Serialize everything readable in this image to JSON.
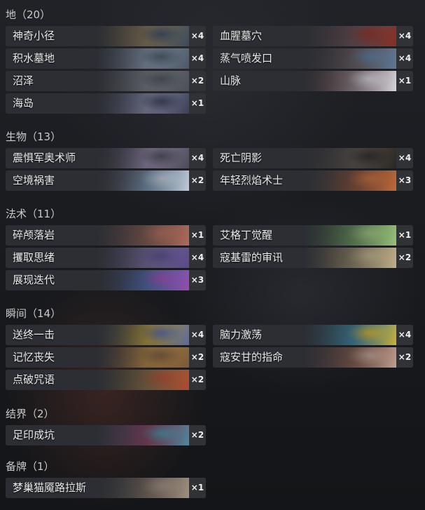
{
  "sections": [
    {
      "title": "地（20）",
      "cards": [
        {
          "name": "神奇小径",
          "qty": "×4",
          "art": [
            "#6e5a3c",
            "#8c7a58",
            "#3a4a5c"
          ]
        },
        {
          "name": "血腥墓穴",
          "qty": "×4",
          "art": [
            "#4a3a44",
            "#6a4a4e",
            "#8a2e24"
          ]
        },
        {
          "name": "积水墓地",
          "qty": "×4",
          "art": [
            "#5a6a7a",
            "#8a9ab0",
            "#4a5866"
          ]
        },
        {
          "name": "蒸气喷发口",
          "qty": "×4",
          "art": [
            "#3a3436",
            "#6a5a5e",
            "#5a7a9a"
          ]
        },
        {
          "name": "沼泽",
          "qty": "×2",
          "art": [
            "#5a5e66",
            "#7a7e86",
            "#4a4e56"
          ]
        },
        {
          "name": "山脉",
          "qty": "×1",
          "art": [
            "#6a3a36",
            "#9a8a8e",
            "#d8d4dc"
          ]
        },
        {
          "name": "海岛",
          "qty": "×1",
          "art": [
            "#4a4e6a",
            "#8a8eb0",
            "#3a3e56"
          ]
        }
      ]
    },
    {
      "title": "生物（13）",
      "cards": [
        {
          "name": "震惧军奥术师",
          "qty": "×4",
          "art": [
            "#3a3a44",
            "#9a8ab0",
            "#4a4a56"
          ]
        },
        {
          "name": "死亡阴影",
          "qty": "×4",
          "art": [
            "#3a3430",
            "#5a5046",
            "#2a2622"
          ]
        },
        {
          "name": "空境祸害",
          "qty": "×2",
          "art": [
            "#4a3a4a",
            "#7a9ab8",
            "#c0cad6"
          ]
        },
        {
          "name": "年轻烈焰术士",
          "qty": "×3",
          "art": [
            "#3a3a3e",
            "#8a4a2e",
            "#c06a3a"
          ]
        }
      ]
    },
    {
      "title": "法术（11）",
      "cards": [
        {
          "name": "碎颅落岩",
          "qty": "×1",
          "art": [
            "#5a4040",
            "#8a5a4a",
            "#b06a5a"
          ]
        },
        {
          "name": "艾格丁觉醒",
          "qty": "×1",
          "art": [
            "#3a5a3a",
            "#6a9a5a",
            "#9ac07a"
          ]
        },
        {
          "name": "攫取思绪",
          "qty": "×4",
          "art": [
            "#4a4a6a",
            "#7a6aa0",
            "#5a4a8a"
          ]
        },
        {
          "name": "寇基雷的审讯",
          "qty": "×2",
          "art": [
            "#6a5a44",
            "#9a8a66",
            "#c0b08a"
          ]
        },
        {
          "name": "展现迭代",
          "qty": "×3",
          "art": [
            "#3a3a5a",
            "#4a6ab0",
            "#9a4ab0"
          ]
        }
      ]
    },
    {
      "title": "瞬间（14）",
      "cards": [
        {
          "name": "送终一击",
          "qty": "×4",
          "art": [
            "#4a4a50",
            "#c0a030",
            "#5a6aa0"
          ]
        },
        {
          "name": "脑力激荡",
          "qty": "×4",
          "art": [
            "#2a5a6a",
            "#3a8aa8",
            "#d0b030"
          ]
        },
        {
          "name": "记忆丧失",
          "qty": "×2",
          "art": [
            "#6a4a3a",
            "#c08a3a",
            "#7a5a3a"
          ]
        },
        {
          "name": "寇安甘的指命",
          "qty": "×2",
          "art": [
            "#5a3a3a",
            "#8a5a4a",
            "#c0a090"
          ]
        },
        {
          "name": "点破咒语",
          "qty": "×2",
          "art": [
            "#5a4a3a",
            "#8a6a3a",
            "#b04a30"
          ]
        }
      ]
    },
    {
      "title": "结界（2）",
      "cards": [
        {
          "name": "足印成坑",
          "qty": "×2",
          "art": [
            "#5a4a6a",
            "#8a3a5a",
            "#4a8aa0"
          ]
        }
      ]
    },
    {
      "title": "备牌（1）",
      "cards": [
        {
          "name": "梦巢猫魇路拉斯",
          "qty": "×1",
          "art": [
            "#3a3a3e",
            "#7a6a5a",
            "#a09080"
          ]
        }
      ]
    }
  ]
}
